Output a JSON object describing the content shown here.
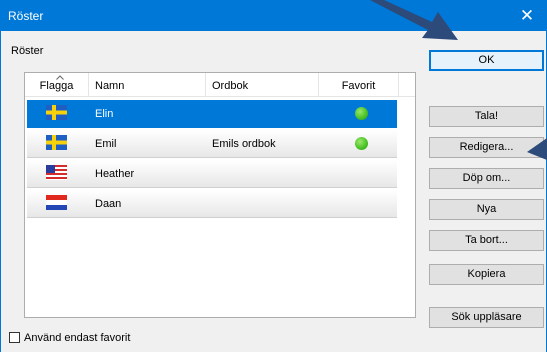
{
  "window": {
    "title": "Röster",
    "close_glyph": "✕",
    "accent_color": "#0078d7"
  },
  "voices_group": {
    "label": "Röster"
  },
  "table": {
    "columns": [
      "Flagga",
      "Namn",
      "Ordbok",
      "Favorit"
    ],
    "rows": [
      {
        "flag": "sweden-flag-icon",
        "name": "Elin",
        "dictionary": "",
        "favorite": true,
        "selected": true
      },
      {
        "flag": "sweden-flag-icon",
        "name": "Emil",
        "dictionary": "Emils ordbok",
        "favorite": true,
        "selected": false
      },
      {
        "flag": "usa-flag-icon",
        "name": "Heather",
        "dictionary": "",
        "favorite": false,
        "selected": false
      },
      {
        "flag": "netherlands-flag-icon",
        "name": "Daan",
        "dictionary": "",
        "favorite": false,
        "selected": false
      }
    ]
  },
  "buttons": {
    "ok": "OK",
    "speak": "Tala!",
    "edit": "Redigera...",
    "rename": "Döp om...",
    "new": "Nya",
    "delete": "Ta bort...",
    "copy": "Kopiera",
    "search_readers": "Sök uppläsare"
  },
  "favorites_only": {
    "label": "Använd endast favorit",
    "checked": false
  },
  "favorite_color": "#4ec42a"
}
